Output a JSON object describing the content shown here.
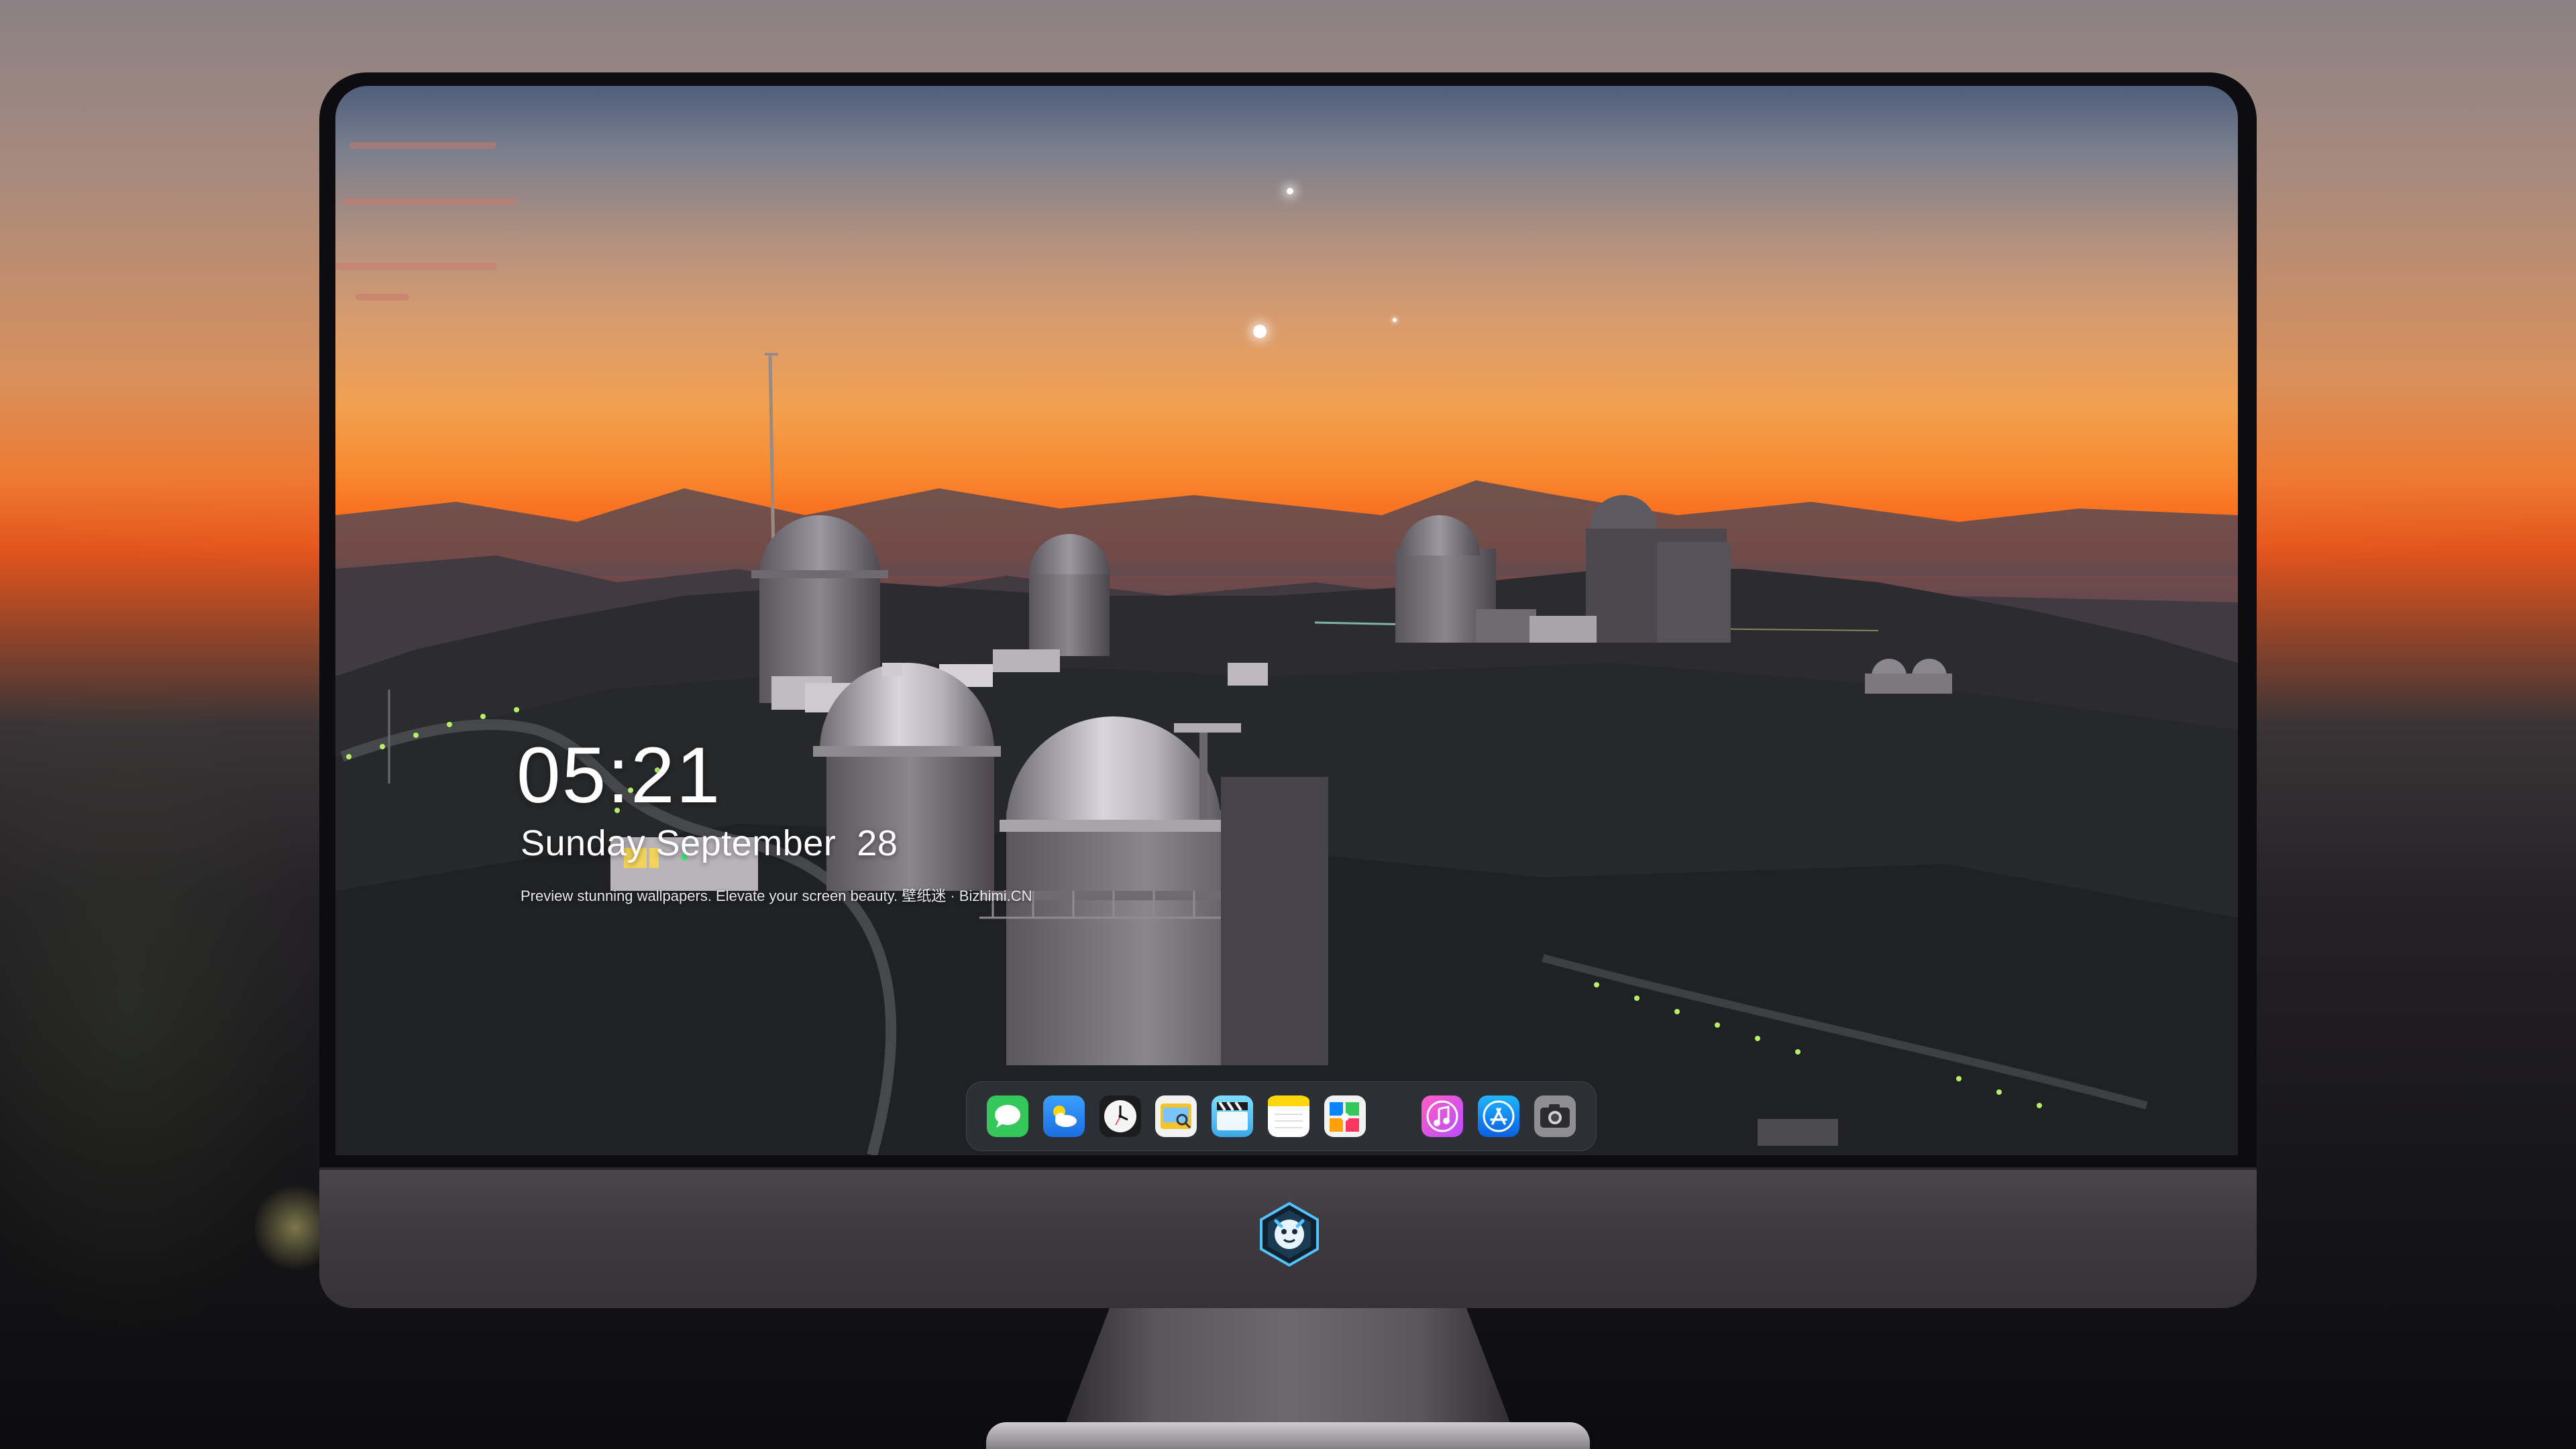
{
  "lock_screen": {
    "time": "05:21",
    "date": "Sunday September  28",
    "tagline": "Preview stunning wallpapers. Elevate your screen beauty. 壁纸迷 · Bizhimi.CN"
  },
  "dock": {
    "apps": [
      {
        "name": "messages-icon",
        "color": "#34c759"
      },
      {
        "name": "weather-icon",
        "color": "#1e90ff"
      },
      {
        "name": "clock-icon",
        "color": "#ffffff"
      },
      {
        "name": "preview-icon",
        "color": "#f4c430"
      },
      {
        "name": "clips-icon",
        "color": "#5ac8fa"
      },
      {
        "name": "notes-icon",
        "color": "#ffd60a"
      },
      {
        "name": "photo-booth-icon",
        "color": "#0a84ff"
      },
      {
        "name": "music-icon",
        "color": "#fc3c8d"
      },
      {
        "name": "app-store-icon",
        "color": "#0a84ff"
      },
      {
        "name": "camera-icon",
        "color": "#8e8e93"
      }
    ]
  },
  "logo": {
    "name": "dragon-mascot-logo",
    "accent": "#4fc3ff"
  }
}
